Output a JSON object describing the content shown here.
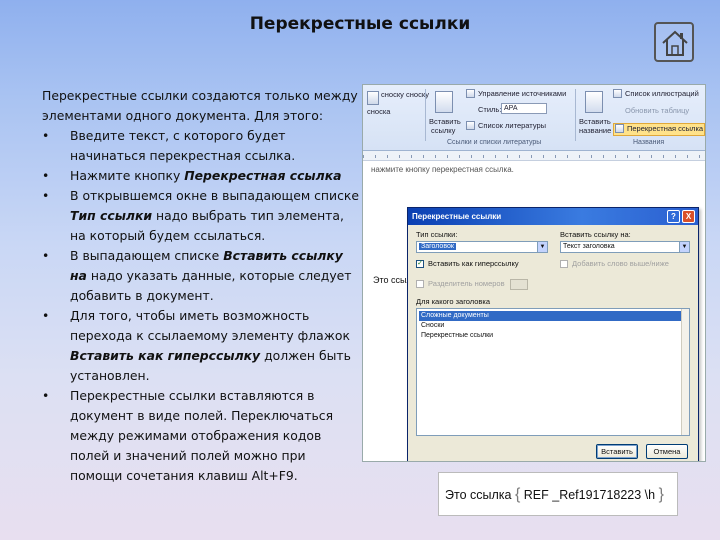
{
  "slide": {
    "title": "Перекрестные ссылки"
  },
  "body": {
    "intro": "Перекрестные ссылки создаются только между элементами одного документа. Для этого:",
    "bullets": [
      {
        "text_before": "Введите текст, с которого будет начинаться перекрестная ссылка.",
        "italic": "",
        "text_after": ""
      },
      {
        "text_before": "Нажмите кнопку ",
        "italic": "Перекрестная ссылка",
        "text_after": ""
      },
      {
        "text_before": "В открывшемся окне в выпадающем списке ",
        "italic": "Тип ссылки",
        "text_after": " надо выбрать тип элемента, на который будем ссылаться."
      },
      {
        "text_before": "В выпадающем списке ",
        "italic": "Вставить ссылку на",
        "text_after": " надо указать данные, которые следует добавить в документ."
      },
      {
        "text_before": "Для того, чтобы иметь возможность перехода к ссылаемому элементу флажок  ",
        "italic": "Вставить как гиперссылку",
        "text_after": " должен быть установлен."
      },
      {
        "text_before": "Перекрестные ссылки вставляются в документ в виде полей. Переключаться между режимами отображения кодов полей и значений полей можно при помощи сочетания клавиш Alt+F9.",
        "italic": "",
        "text_after": ""
      }
    ]
  },
  "word": {
    "ribbon": {
      "footnote_btn": "сноску сноску",
      "insert_footnote": "сноска",
      "manage_sources": "Управление источниками",
      "style_label": "Стиль:",
      "style_value": "APA",
      "insert_citation": "Вставить",
      "insert_citation_2": "ссылку",
      "bibliography": "Список литературы",
      "insert_caption": "Вставить",
      "insert_caption_2": "название",
      "table_of_figures": "Список иллюстраций",
      "update_table": "Обновить таблицу",
      "cross_reference": "Перекрестная ссылка",
      "group_citations": "Ссылки и списки литературы",
      "group_captions": "Названия"
    },
    "doc": {
      "cut_text": "нажмите кнопку перекрестная ссылка.",
      "line_text": "Это ссылка"
    },
    "dialog": {
      "title": "Перекрестные ссылки",
      "help": "?",
      "close": "X",
      "ref_type_label": "Тип ссылки:",
      "ref_type_value": "Заголовок",
      "insert_ref_to_label": "Вставить ссылку на:",
      "insert_ref_to_value": "Текст заголовка",
      "hyperlink_label": "Вставить как гиперссылку",
      "above_below_label": "Добавить слово выше/ниже",
      "para_number_label": "Разделитель номеров",
      "for_which_label": "Для какого заголовка",
      "headings": [
        "Сложные документы",
        "Сноски",
        "Перекрестные ссылки"
      ],
      "selected_index": 0,
      "insert_btn": "Вставить",
      "cancel_btn": "Отмена",
      "hyperlink_checked": true
    }
  },
  "field_code": {
    "prefix": "Это ссылка ",
    "open": "{",
    "code": " REF _Ref191718223 \\h ",
    "close": "}"
  }
}
